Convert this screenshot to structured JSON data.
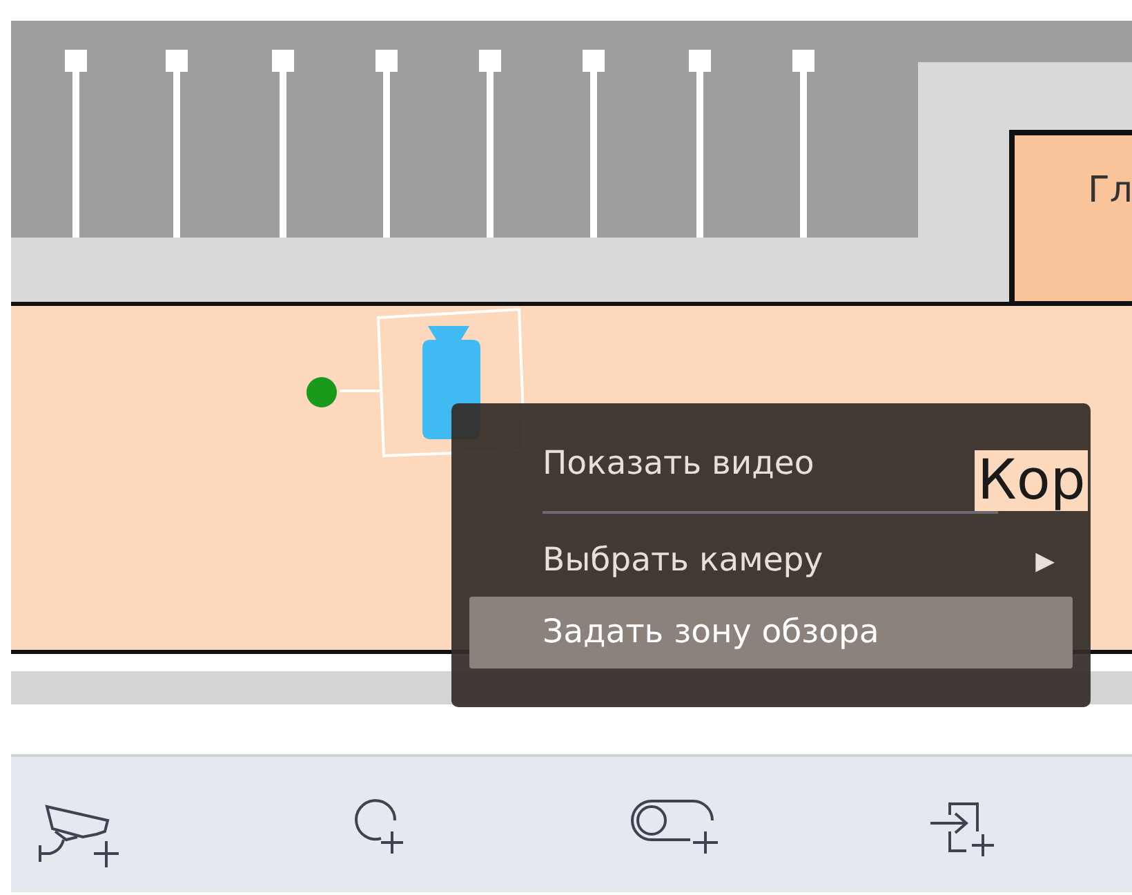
{
  "floor_plan": {
    "room_label": "Гл",
    "corridor_label": "Кор",
    "camera": {
      "selected": true
    }
  },
  "context_menu": {
    "items": [
      {
        "kind": "item",
        "label": "Показать видео",
        "selected": false
      },
      {
        "kind": "separator"
      },
      {
        "kind": "submenu",
        "label": "Выбрать камеру",
        "arrow": "▶",
        "selected": false
      },
      {
        "kind": "item",
        "label": "Задать зону обзора",
        "selected": true
      }
    ]
  }
}
